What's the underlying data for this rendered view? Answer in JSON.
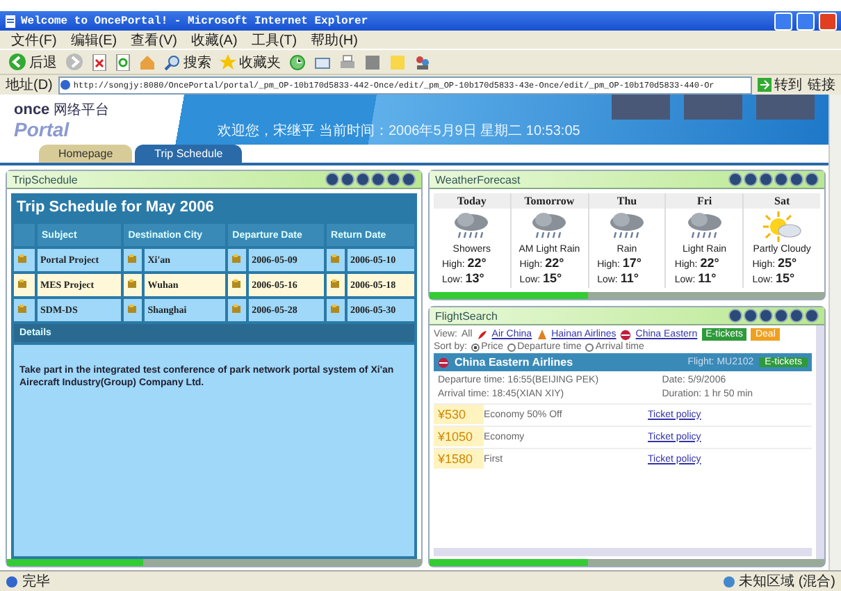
{
  "window": {
    "title": "Welcome to OncePortal! - Microsoft Internet Explorer"
  },
  "menu": [
    "文件(F)",
    "编辑(E)",
    "查看(V)",
    "收藏(A)",
    "工具(T)",
    "帮助(H)"
  ],
  "toolbar": {
    "back": "后退",
    "search": "搜索",
    "favorites": "收藏夹"
  },
  "address_bar": {
    "label": "地址(D)",
    "url": "http://songjy:8080/OncePortal/portal/_pm_OP-10b170d5833-442-Once/edit/_pm_OP-10b170d5833-43e-Once/edit/_pm_OP-10b170d5833-440-Or",
    "go": "转到",
    "links": "链接"
  },
  "header": {
    "logo_text": "once",
    "logo_subtitle": "网络平台",
    "logo_title": "Portal",
    "welcome": "欢迎您，宋继平 当前时间：2006年5月9日 星期二 10:53:05"
  },
  "tabs": [
    {
      "label": "Homepage",
      "selected": false
    },
    {
      "label": "Trip Schedule",
      "selected": true
    }
  ],
  "trip_schedule": {
    "panel_title": "TripSchedule",
    "progress": {
      "level": 0.33
    },
    "title": "Trip Schedule for May 2006",
    "columns": [
      "Subject",
      "Destination City",
      "Departure Date",
      "Return Date"
    ],
    "rows": [
      {
        "subject": "Portal Project",
        "city": "Xi'an",
        "departure": "2006-05-09",
        "return": "2006-05-10",
        "selected": false
      },
      {
        "subject": "MES Project",
        "city": "Wuhan",
        "departure": "2006-05-16",
        "return": "2006-05-18",
        "selected": true
      },
      {
        "subject": "SDM-DS",
        "city": "Shanghai",
        "departure": "2006-05-28",
        "return": "2006-05-30",
        "selected": false
      }
    ],
    "details_title": "Details",
    "details": "Take part in the integrated test conference of park network portal system of Xi'an Airecraft Industry(Group) Company Ltd."
  },
  "weather": {
    "panel_title": "WeatherForecast",
    "progress": {
      "level": 0.4
    },
    "days": [
      {
        "day": "Today",
        "kind": "rain",
        "condition": "Showers",
        "high_label": "High:",
        "high": "22°",
        "low_label": "Low:",
        "low": "13°"
      },
      {
        "day": "Tomorrow",
        "kind": "rain",
        "condition": "AM Light Rain",
        "high_label": "High:",
        "high": "22°",
        "low_label": "Low:",
        "low": "15°"
      },
      {
        "day": "Thu",
        "kind": "rain",
        "condition": "Rain",
        "high_label": "High:",
        "high": "17°",
        "low_label": "Low:",
        "low": "11°"
      },
      {
        "day": "Fri",
        "kind": "rain",
        "condition": "Light Rain",
        "high_label": "High:",
        "high": "22°",
        "low_label": "Low:",
        "low": "11°"
      },
      {
        "day": "Sat",
        "kind": "sun",
        "condition": "Partly Cloudy",
        "high_label": "High:",
        "high": "25°",
        "low_label": "Low:",
        "low": "15°"
      }
    ]
  },
  "flight_search": {
    "panel_title": "FlightSearch",
    "progress": {
      "level": 0.4
    },
    "view_label": "View:",
    "filters": [
      {
        "kind": "plain",
        "label": "All"
      },
      {
        "kind": "bird",
        "label": "Air China"
      },
      {
        "kind": "sail",
        "label": "Hainan Airlines"
      },
      {
        "kind": "ball",
        "label": "China Eastern"
      },
      {
        "kind": "badge",
        "label": "E-tickets",
        "color": "#2e9a3a"
      },
      {
        "kind": "badge",
        "label": "Deal",
        "color": "#f0a020"
      }
    ],
    "sort_label": "Sort by:",
    "sort_options": [
      {
        "label": "Price",
        "selected": true
      },
      {
        "label": "Departure time",
        "selected": false
      },
      {
        "label": "Arrival time",
        "selected": false
      }
    ],
    "flight": {
      "airline": "China Eastern Airlines",
      "number": "Flight: MU2102",
      "badge": "E-tickets",
      "departure": "Departure time: 16:55(BEIJING PEK)",
      "date": "Date: 5/9/2006",
      "arrival": "Arrival time: 18:45(XIAN XIY)",
      "duration": "Duration: 1 hr 50 min"
    },
    "fares": [
      {
        "price": "¥530",
        "class": "Economy 50% Off",
        "policy": "Ticket policy"
      },
      {
        "price": "¥1050",
        "class": "Economy",
        "policy": "Ticket policy"
      },
      {
        "price": "¥1580",
        "class": "First",
        "policy": "Ticket policy"
      }
    ]
  },
  "status_bar": {
    "text": "完毕",
    "zone": "未知区域 (混合)"
  }
}
